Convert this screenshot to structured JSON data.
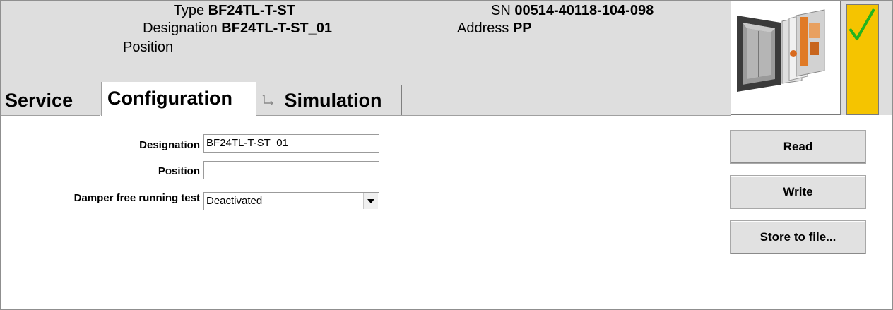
{
  "header": {
    "type_label": "Type",
    "type_value": "BF24TL-T-ST",
    "designation_label": "Designation",
    "designation_value": "BF24TL-T-ST_01",
    "position_label": "Position",
    "sn_label": "SN",
    "sn_value": "00514-40118-104-098",
    "address_label": "Address",
    "address_value": "PP",
    "device_image_icon": "damper-actuator-image",
    "status_icon": "checkmark-icon",
    "status_color": "#f5c400",
    "check_color": "#22b41e"
  },
  "tabs": [
    {
      "label": "Service"
    },
    {
      "label": "Configuration",
      "active": true
    },
    {
      "label": "Simulation",
      "icon": "simulation-icon"
    }
  ],
  "form": {
    "designation_label": "Designation",
    "designation_value": "BF24TL-T-ST_01",
    "position_label": "Position",
    "position_value": "",
    "damper_label": "Damper free running test",
    "damper_value": "Deactivated"
  },
  "buttons": {
    "read": "Read",
    "write": "Write",
    "store": "Store to file..."
  }
}
